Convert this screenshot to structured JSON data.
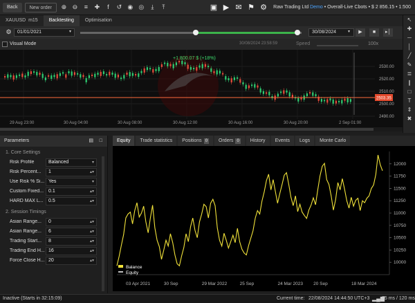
{
  "toolbar": {
    "back_label": "Back",
    "new_order_label": "New order",
    "icons": [
      "zoom-in-icon",
      "zoom-out-icon",
      "timeframe-icon",
      "crosshair-icon",
      "facebook-icon",
      "undo-icon",
      "eye-icon",
      "hide-icon",
      "download-icon",
      "upload-icon"
    ],
    "media_icons": [
      "camera-icon",
      "video-icon",
      "envelope-icon",
      "flag-icon",
      "gear-icon"
    ]
  },
  "broker": {
    "name": "Raw Trading Ltd",
    "demo": "Demo",
    "account": "Overall-Live Cbots",
    "balance": "$ 2 856.15",
    "leverage": "1:500"
  },
  "tabs_top": {
    "symbol": "XAUUSD",
    "timeframe": "m15",
    "backtesting": "Backtesting",
    "optimisation": "Optimisation"
  },
  "daterange": {
    "start": "01/01/2021",
    "end": "30/08/2024"
  },
  "visual": {
    "label": "Visual Mode",
    "timestamp": "30/08/2024 23:58:59",
    "speed_label": "Speed",
    "speed_value": "100x"
  },
  "chart": {
    "pnl_label": "+1 800.07 $ (+18%)",
    "current_price": "2503.35",
    "y_ticks": [
      "2530.00",
      "2520.00",
      "2510.00",
      "2500.00",
      "2490.00"
    ],
    "x_ticks": [
      "29 Aug 23:00",
      "30 Aug 04:00",
      "30 Aug 08:00",
      "30 Aug 12:00",
      "30 Aug 16:00",
      "30 Aug 20:00",
      "2 Sep 01:00"
    ],
    "colors": {
      "up": "#2ecc71",
      "down": "#e74c3c",
      "price_line": "#ff6a3c"
    }
  },
  "params": {
    "title": "Parameters",
    "sections": [
      {
        "title": "1. Core Settings",
        "rows": [
          {
            "label": "Risk Profile",
            "value": "Balanced",
            "dropdown": true
          },
          {
            "label": "Risk Percent...",
            "value": "1",
            "dropdown": false
          },
          {
            "label": "Use Risk % Si...",
            "value": "Yes",
            "dropdown": true
          },
          {
            "label": "Custom Fixed...",
            "value": "0.1",
            "dropdown": false
          },
          {
            "label": "HARD MAX L...",
            "value": "0.5",
            "dropdown": false
          }
        ]
      },
      {
        "title": "2. Session Timings",
        "rows": [
          {
            "label": "Asian Range...",
            "value": "0",
            "dropdown": false
          },
          {
            "label": "Asian Range...",
            "value": "6",
            "dropdown": false
          },
          {
            "label": "Trading Start...",
            "value": "8",
            "dropdown": false
          },
          {
            "label": "Trading End H...",
            "value": "16",
            "dropdown": false
          },
          {
            "label": "Force Close H...",
            "value": "20",
            "dropdown": false
          }
        ]
      }
    ]
  },
  "bottom_tabs": [
    {
      "label": "Equity",
      "count": null
    },
    {
      "label": "Trade statistics",
      "count": null
    },
    {
      "label": "Positions",
      "count": "0"
    },
    {
      "label": "Orders",
      "count": "0"
    },
    {
      "label": "History",
      "count": null
    },
    {
      "label": "Events",
      "count": null
    },
    {
      "label": "Logs",
      "count": null
    },
    {
      "label": "Monte Carlo",
      "count": null
    }
  ],
  "chart_data": {
    "type": "line",
    "title": "",
    "xlabel": "",
    "ylabel": "",
    "ylim": [
      9750,
      12250
    ],
    "y_ticks": [
      10000,
      10250,
      10500,
      10750,
      11000,
      11250,
      11500,
      11750,
      12000
    ],
    "x_ticks": [
      "03 Apr 2021",
      "30 Sep",
      "29 Mar 2022",
      "25 Sep",
      "24 Mar 2023",
      "20 Sep",
      "18 Mar 2024"
    ],
    "legend": "bottom-left",
    "grid": false,
    "series": [
      {
        "name": "Balance",
        "color": "#f2e33a",
        "values": [
          9930,
          10120,
          10350,
          10560,
          10900,
          10980,
          11020,
          10780,
          11050,
          11210,
          10920,
          11000,
          11140,
          10820,
          10600,
          10900,
          11160,
          10700,
          10450,
          10320,
          10060,
          10250,
          10450,
          10330,
          10580,
          10400,
          10150,
          9970,
          9930,
          10130,
          10300,
          10580,
          10420,
          10720,
          10900,
          10650,
          10500,
          10820,
          10980,
          11180,
          11130,
          10900,
          11200,
          11280,
          11150,
          10700,
          10450,
          10330,
          10590,
          10450,
          10290,
          10420,
          10550,
          10400,
          10690,
          10420,
          10270,
          10190,
          10150,
          10340,
          10490,
          10640,
          10900,
          11050,
          10980,
          11240,
          11430,
          11660,
          11790,
          11470,
          11680,
          11440,
          11200,
          11400,
          11580,
          11770,
          11820,
          11580,
          11320,
          11150,
          11350,
          11030,
          11180,
          11020,
          10950,
          10890,
          11060,
          11160,
          11310,
          11170,
          11470,
          11750,
          11950,
          12010,
          11680,
          11580,
          11350,
          11060,
          11270,
          11620,
          11470,
          11700,
          11490,
          11250,
          11100,
          11320,
          11140,
          11260,
          11300,
          11050,
          11250,
          11210,
          11300,
          11350,
          11500,
          11570,
          11780,
          12180,
          11980,
          11860
        ]
      },
      {
        "name": "Equity",
        "color": "#c0c0c0",
        "values": []
      }
    ]
  },
  "status": {
    "left": "Inactive (Starts in 32:15:09)",
    "current_time_label": "Current time:",
    "current_time": "22/08/2024 14:44:50",
    "utc": "UTC+3",
    "ping": "75 ms / 120 ms"
  }
}
